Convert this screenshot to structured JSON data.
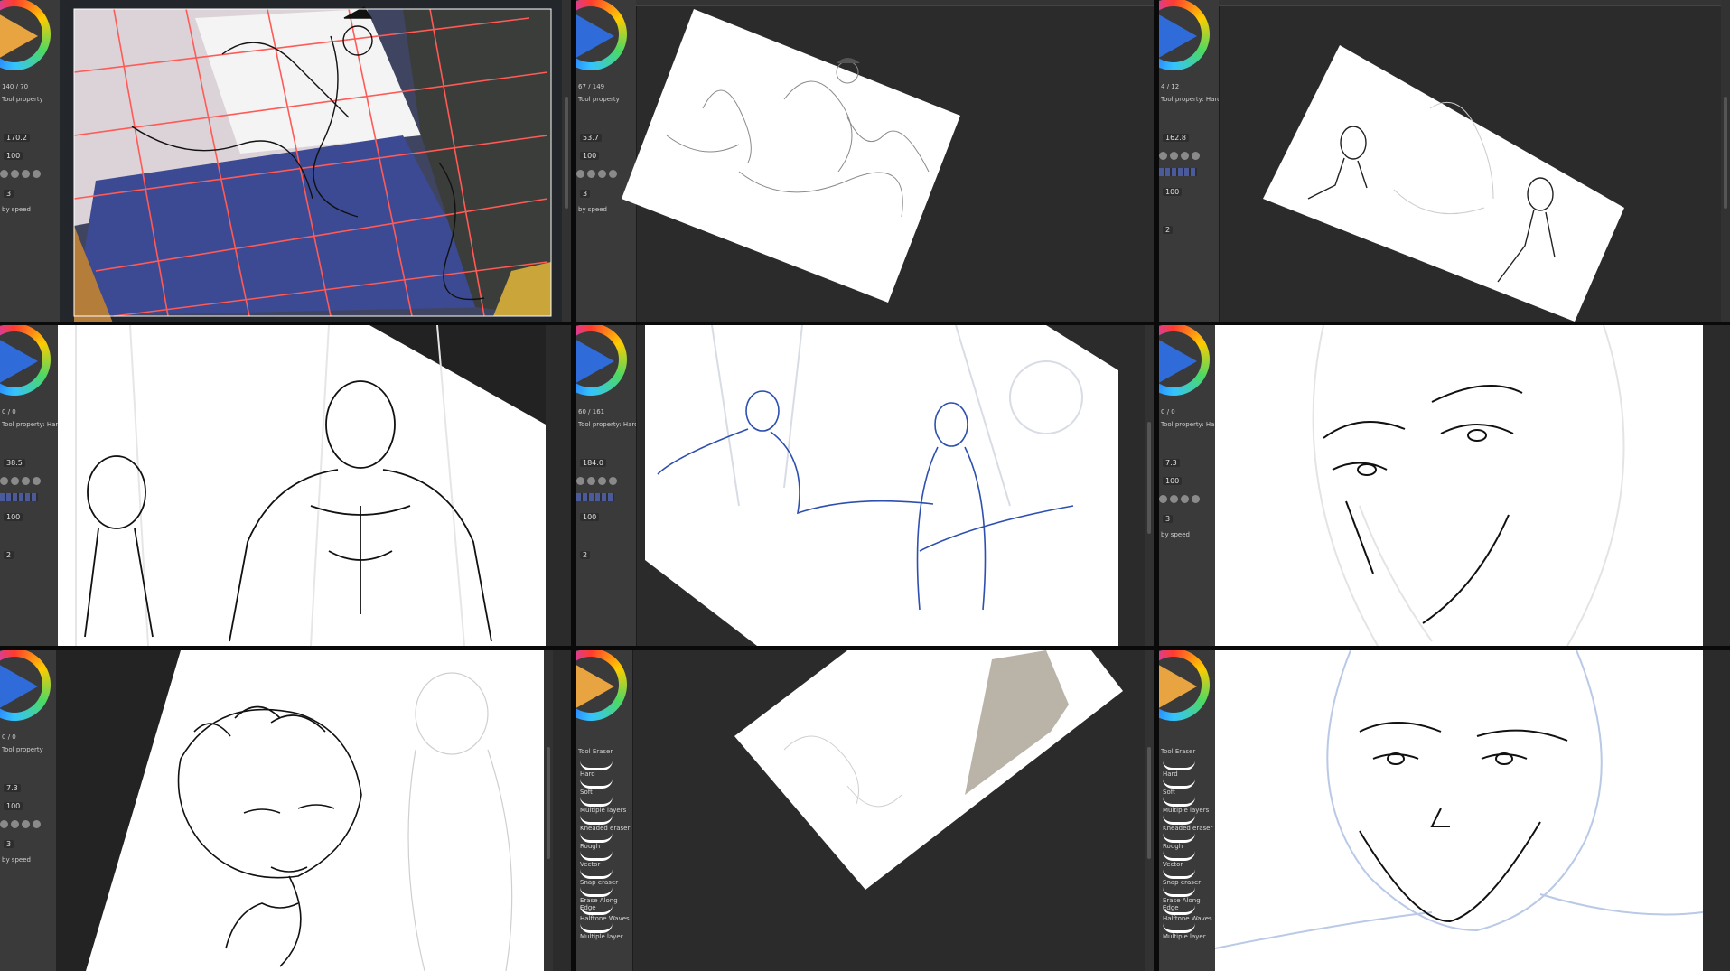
{
  "panels": [
    {
      "id": "p1",
      "wheel_value": "140",
      "wheel_value2": "70",
      "size": "170.2",
      "opacity": "100",
      "count": "3",
      "extra": "by speed",
      "tool_prop": "Tool property",
      "theme": "orange"
    },
    {
      "id": "p2",
      "wheel_value": "67",
      "wheel_value2": "149",
      "size": "53.7",
      "opacity": "100",
      "count": "3",
      "extra": "by speed",
      "tool_prop": "Tool property",
      "theme": "blue"
    },
    {
      "id": "p3",
      "wheel_value": "4",
      "wheel_value2": "12",
      "size": "162.8",
      "opacity": "100",
      "count": "2",
      "extra": "",
      "tool_prop": "Tool property: Hard",
      "theme": "blue"
    },
    {
      "id": "p4",
      "wheel_value": "0",
      "wheel_value2": "0",
      "size": "38.5",
      "opacity": "100",
      "count": "2",
      "extra": "",
      "tool_prop": "Tool property: Hard",
      "theme": "blue"
    },
    {
      "id": "p5",
      "wheel_value": "60",
      "wheel_value2": "161",
      "size": "184.0",
      "opacity": "100",
      "count": "2",
      "extra": "",
      "tool_prop": "Tool property: Hard",
      "theme": "blue"
    },
    {
      "id": "p6",
      "wheel_value": "0",
      "wheel_value2": "0",
      "size": "7.3",
      "opacity": "100",
      "count": "3",
      "extra": "by speed",
      "tool_prop": "Tool property: Hard",
      "theme": "blue"
    },
    {
      "id": "p7",
      "wheel_value": "0",
      "wheel_value2": "0",
      "size": "7.3",
      "opacity": "100",
      "count": "3",
      "extra": "by speed",
      "tool_prop": "Tool property",
      "theme": "blue"
    },
    {
      "id": "p8",
      "tool_prop": "Tool Eraser",
      "theme": "orange",
      "brushes": [
        "Hard",
        "Soft",
        "Multiple layers",
        "Kneaded eraser",
        "Rough",
        "Vector",
        "Snap eraser",
        "Erase Along Edge",
        "Halftone Waves",
        "Multiple layer"
      ]
    },
    {
      "id": "p9",
      "tool_prop": "Tool Eraser",
      "theme": "orange",
      "brushes": [
        "Hard",
        "Soft",
        "Multiple layers",
        "Kneaded eraser",
        "Rough",
        "Vector",
        "Snap eraser",
        "Erase Along Edge",
        "Halftone Waves",
        "Multiple layer"
      ]
    }
  ]
}
